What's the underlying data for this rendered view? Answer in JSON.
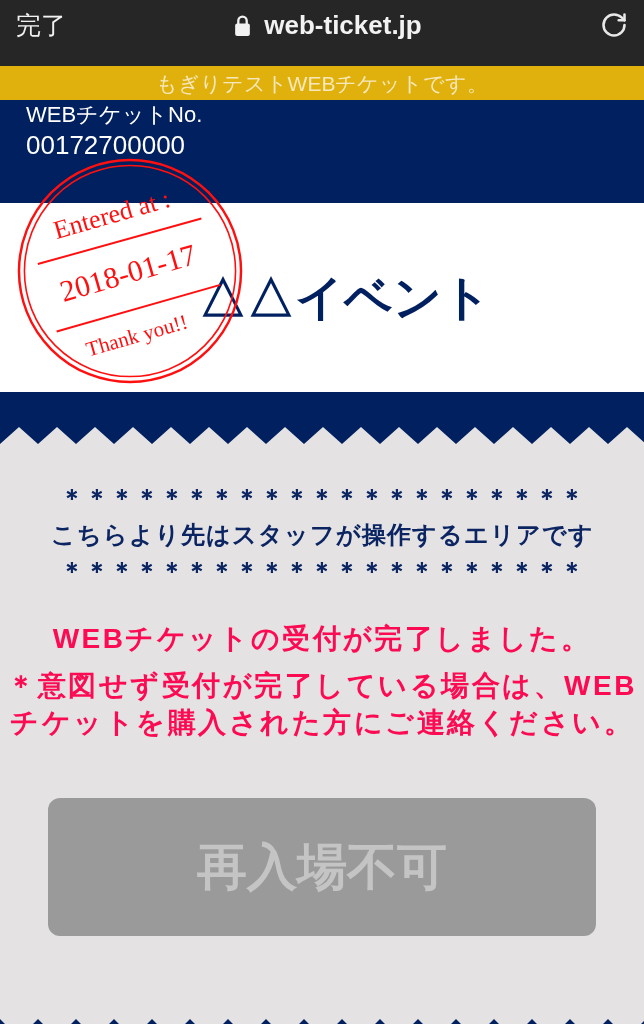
{
  "browser_bar": {
    "done_label": "完了",
    "url": "web-ticket.jp"
  },
  "test_banner": "もぎりテストWEBチケットです。",
  "ticket_header": {
    "label": "WEBチケットNo.",
    "number": "00172700000"
  },
  "event": {
    "title": "△△イベント"
  },
  "stamp": {
    "heading": "Entered at :",
    "date": "2018-01-17",
    "footer": "Thank you!!"
  },
  "staff_notice": {
    "top_line": "＊＊＊＊＊＊＊＊＊＊＊＊＊＊＊＊＊＊＊＊＊",
    "text": "こちらより先はスタッフが操作するエリアです",
    "bottom_line": "＊＊＊＊＊＊＊＊＊＊＊＊＊＊＊＊＊＊＊＊＊"
  },
  "status_message": "WEBチケットの受付が完了しました。",
  "note": "＊意図せず受付が完了している場合は、WEBチケットを購入された方にご連絡ください。",
  "reentry_button": {
    "label": "再入場不可",
    "disabled": true
  }
}
